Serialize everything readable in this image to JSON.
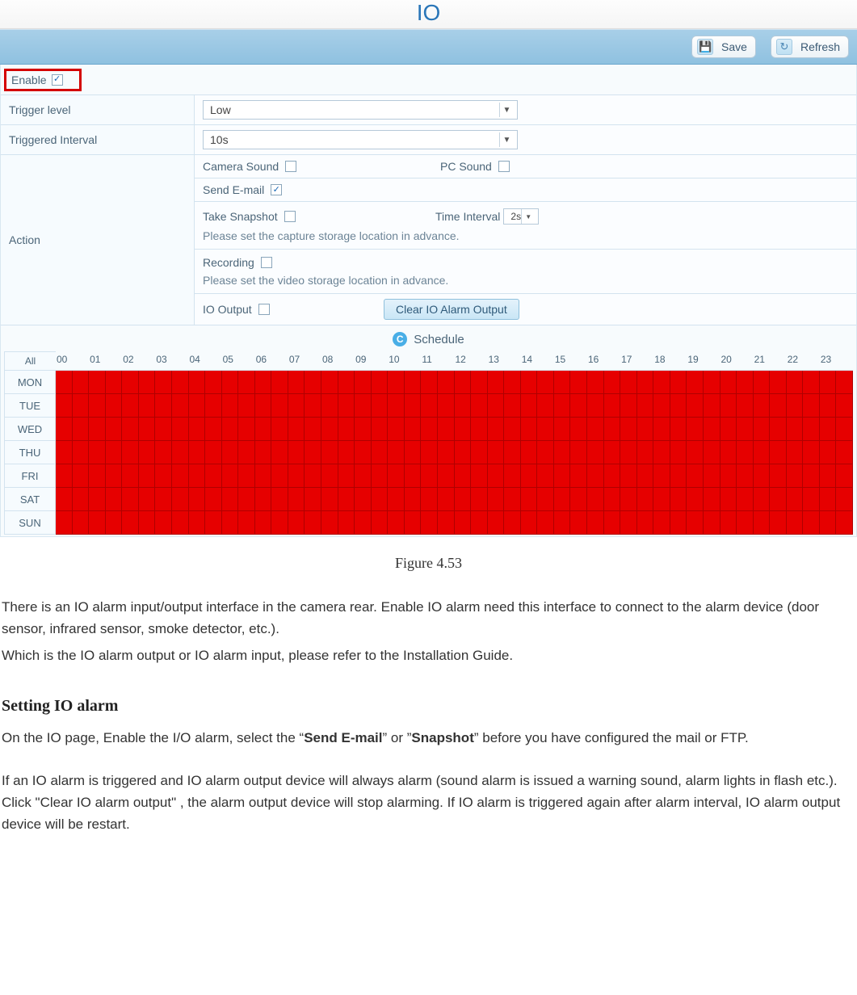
{
  "titlebar": {
    "title": "IO"
  },
  "toolbar": {
    "save": "Save",
    "refresh": "Refresh"
  },
  "form": {
    "enable_label": "Enable",
    "enable_checked": true,
    "trigger_level_label": "Trigger level",
    "trigger_level_value": "Low",
    "triggered_interval_label": "Triggered Interval",
    "triggered_interval_value": "10s",
    "action_label": "Action",
    "action": {
      "camera_sound_label": "Camera Sound",
      "camera_sound_checked": false,
      "pc_sound_label": "PC Sound",
      "pc_sound_checked": false,
      "send_email_label": "Send E-mail",
      "send_email_checked": true,
      "take_snapshot_label": "Take Snapshot",
      "take_snapshot_checked": false,
      "time_interval_label": "Time Interval",
      "time_interval_value": "2s",
      "capture_hint": "Please set the capture storage location in advance.",
      "recording_label": "Recording",
      "recording_checked": false,
      "video_hint": "Please set the video storage location in advance.",
      "io_output_label": "IO Output",
      "io_output_checked": false,
      "clear_btn": "Clear IO Alarm Output"
    }
  },
  "schedule": {
    "heading": "Schedule",
    "all": "All",
    "hours": [
      "00",
      "01",
      "02",
      "03",
      "04",
      "05",
      "06",
      "07",
      "08",
      "09",
      "10",
      "11",
      "12",
      "13",
      "14",
      "15",
      "16",
      "17",
      "18",
      "19",
      "20",
      "21",
      "22",
      "23"
    ],
    "days": [
      "MON",
      "TUE",
      "WED",
      "THU",
      "FRI",
      "SAT",
      "SUN"
    ]
  },
  "caption": "Figure 4.53",
  "doc": {
    "p1": "There is an IO alarm input/output interface in the camera rear. Enable IO alarm need this interface to connect to the alarm device (door sensor, infrared sensor, smoke detector, etc.).",
    "p2": "Which is the IO alarm output or IO alarm input, please refer to the Installation Guide.",
    "h1": "Setting IO alarm",
    "p3a": "On the IO page, Enable the I/O alarm, select the “",
    "p3b1": "Send E-mail",
    "p3c": "” or ”",
    "p3b2": "Snapshot",
    "p3d": "” before you have configured the mail or FTP.",
    "p4": "If an IO alarm is triggered and IO alarm output device will always alarm (sound alarm is issued a warning sound, alarm lights in flash etc.). Click \"Clear IO alarm output\" , the alarm output device will stop alarming. If IO alarm is triggered again after alarm interval, IO alarm output device will be restart."
  }
}
